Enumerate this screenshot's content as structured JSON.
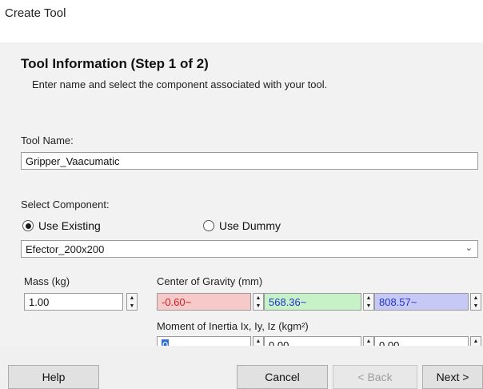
{
  "window": {
    "title": "Create Tool"
  },
  "header": {
    "title": "Tool Information (Step 1 of 2)",
    "subtitle": "Enter name and select the component associated with your tool."
  },
  "tool_name": {
    "label": "Tool Name:",
    "value": "Gripper_Vaacumatic"
  },
  "component": {
    "label": "Select Component:",
    "radio_existing": "Use Existing",
    "radio_dummy": "Use Dummy",
    "selected_option": "existing",
    "dropdown_value": "Efector_200x200"
  },
  "mass": {
    "label": "Mass (kg)",
    "value": "1.00"
  },
  "cog": {
    "label": "Center of Gravity (mm)",
    "x": "-0.60~",
    "y": "568.36~",
    "z": "808.57~"
  },
  "inertia": {
    "label": "Moment of Inertia Ix, Iy, Iz (kgm²)",
    "ix": "0",
    "iy": "0.00",
    "iz": "0.00"
  },
  "buttons": {
    "help": "Help",
    "cancel": "Cancel",
    "back": "< Back",
    "next": "Next >"
  },
  "colors": {
    "cog_x_bg": "#f8c9c9",
    "cog_y_bg": "#c7f1c7",
    "cog_z_bg": "#c6c9f6",
    "selection": "#2f6fd6"
  }
}
